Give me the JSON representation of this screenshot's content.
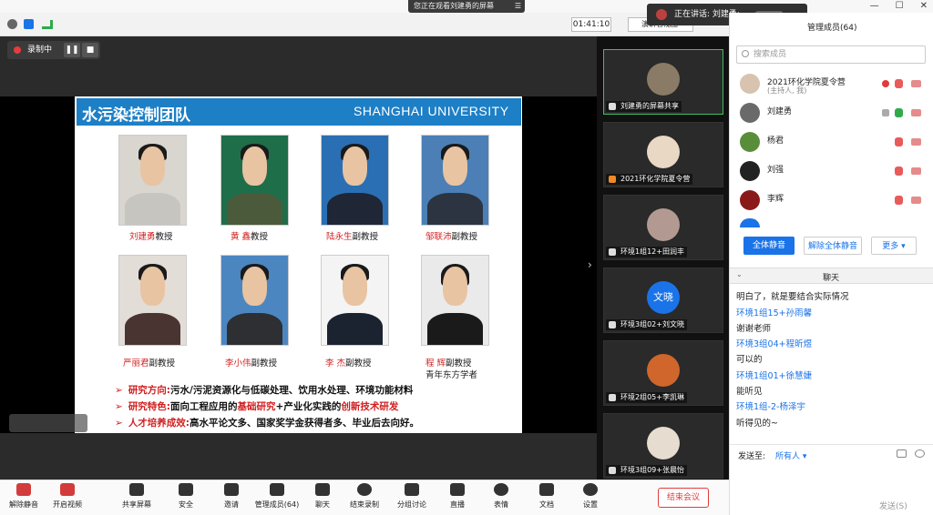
{
  "sharing_banner": "您正在观看刘建勇的屏幕",
  "window_controls": [
    "—",
    "☐",
    "✕"
  ],
  "timer": "01:41:10",
  "view_button": "演讲者视图",
  "speaking_label": "正在讲话: 刘建勇;",
  "recording": {
    "label": "录制中"
  },
  "slide": {
    "title": "水污染控制团队",
    "university": "SHANGHAI UNIVERSITY",
    "people": [
      {
        "name": "刘建勇",
        "title": "教授"
      },
      {
        "name": "黄    鑫",
        "title": "教授"
      },
      {
        "name": "陆永生",
        "title": "副教授"
      },
      {
        "name": "邹联沛",
        "title": "副教授"
      },
      {
        "name": "严丽君",
        "title": "副教授"
      },
      {
        "name": "李小伟",
        "title": "副教授"
      },
      {
        "name": "李    杰",
        "title": "副教授"
      },
      {
        "name": "程    辉",
        "title": "副教授",
        "note": "青年东方学者"
      }
    ],
    "bullets": [
      {
        "key": "研究方向:",
        "value": "污水/污泥资源化与低碳处理、饮用水处理、环境功能材料"
      },
      {
        "key": "研究特色:",
        "value_a": "面向工程应用的",
        "hl1": "基础研究",
        "value_b": "+产业化实践的",
        "hl2": "创新技术研发"
      },
      {
        "key": "人才培养成效:",
        "value": "高水平论文多、国家奖学金获得者多、毕业后去向好。"
      }
    ]
  },
  "thumbnails": [
    {
      "label": "刘建勇的屏幕共享",
      "avatar_color": "#8a7b66"
    },
    {
      "label": "2021环化学院夏令营",
      "avatar_color": "#e8d8c4"
    },
    {
      "label": "环境1组12+田润丰",
      "avatar_color": "#b29a92"
    },
    {
      "label": "环境3组02+刘文晓",
      "avatar_text": "文晓",
      "avatar_color": "#1a73e8"
    },
    {
      "label": "环境2组05+李凯琳",
      "avatar_color": "#d0662c"
    },
    {
      "label": "环境3组09+张晨怡",
      "avatar_color": "#e6dcd0"
    }
  ],
  "panel": {
    "title": "管理成员(64)",
    "search_placeholder": "搜索成员",
    "members": [
      {
        "name": "2021环化学院夏令营",
        "sub": "(主持人, 我)",
        "color": "#d8c2b0"
      },
      {
        "name": "刘建勇",
        "color": "#6a6a6a"
      },
      {
        "name": "杨君",
        "color": "#5a8d3a"
      },
      {
        "name": "刘强",
        "color": "#222222"
      },
      {
        "name": "李辉",
        "color": "#8a1a1a"
      }
    ],
    "mute_all": "全体静音",
    "unmute_all": "解除全体静音",
    "more": "更多 ▾",
    "chat_title": "聊天",
    "chat": [
      {
        "type": "msg",
        "text": "明白了，就是要结合实际情况"
      },
      {
        "type": "sender",
        "text": "环境1组15+孙雨馨"
      },
      {
        "type": "msg",
        "text": "谢谢老师"
      },
      {
        "type": "sender",
        "text": "环境3组04+程昕煜"
      },
      {
        "type": "msg",
        "text": "可以的"
      },
      {
        "type": "sender",
        "text": "环境1组01+徐慧婕"
      },
      {
        "type": "msg",
        "text": "能听见"
      },
      {
        "type": "sender",
        "text": "环境1组-2-杨泽宇"
      },
      {
        "type": "msg",
        "text": "听得见的~"
      }
    ],
    "send_to_label": "发送至:",
    "send_to_value": "所有人 ▾",
    "send_button": "发送(S)"
  },
  "toolbar": {
    "items": [
      "解除静音",
      "开启视频",
      "共享屏幕",
      "安全",
      "邀请",
      "管理成员(64)",
      "聊天",
      "结束录制",
      "分组讨论",
      "直播",
      "表情",
      "文档",
      "设置"
    ],
    "end_meeting": "结束会议"
  }
}
